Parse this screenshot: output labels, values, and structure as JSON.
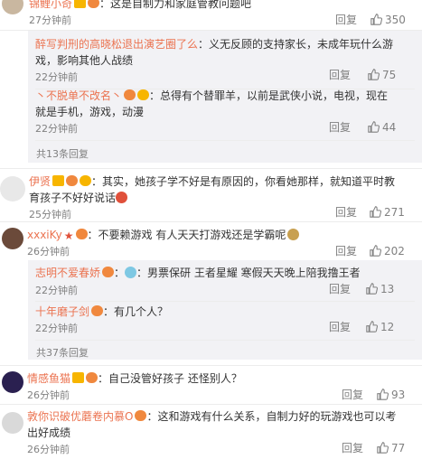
{
  "comments": [
    {
      "name": "锦鲤小奇",
      "text": "：这是自制力和家庭管教问题吧",
      "time": "27分钟前",
      "reply": "回复",
      "likes": "350"
    },
    {
      "name": "醉写判刑的高晓松退出演艺圈了么",
      "text1": "：义无反顾的支持家长，未成年玩什么游",
      "text2": "戏，影响其他人战绩",
      "time": "22分钟前",
      "reply": "回复",
      "likes": "75"
    },
    {
      "name": "丶不脱单不改名丶",
      "text1": "：总得有个替罪羊，以前是武侠小说，电视，现在",
      "text2": "就是手机，游戏，动漫",
      "time": "22分钟前",
      "reply": "回复",
      "likes": "44"
    },
    {
      "more": "共13条回复"
    },
    {
      "name": "伊贤",
      "text1": "：其实，她孩子学不好是有原因的，你看她那样，就知道平时教",
      "text2": "育孩子不好好说话",
      "time": "25分钟前",
      "reply": "回复",
      "likes": "271"
    },
    {
      "name": "xxxiKy",
      "text": "：不要赖游戏 有人天天打游戏还是学霸呢",
      "time": "26分钟前",
      "reply": "回复",
      "likes": "202"
    },
    {
      "name": "志明不爱春娇",
      "text": "：男票保研 王者星耀 寒假天天晚上陪我撸王者",
      "time": "22分钟前",
      "reply": "回复",
      "likes": "13"
    },
    {
      "name": "十年磨子剑",
      "text": "：有几个人？",
      "time": "22分钟前",
      "reply": "回复",
      "likes": "12"
    },
    {
      "more": "共37条回复"
    },
    {
      "name": "情感鱼猫",
      "text": "：自己没管好孩子 还怪别人？",
      "time": "26分钟前",
      "reply": "回复",
      "likes": "93"
    },
    {
      "name": "敦你识破优蘑卷内慕O",
      "text1": "：这和游戏有什么关系，自制力好的玩游戏也可以考",
      "text2": "出好成绩",
      "time": "26分钟前",
      "reply": "回复",
      "likes": "77"
    }
  ],
  "colors": {
    "name": "#eb7350",
    "meta": "#808080",
    "sub_bg": "#f2f2f5",
    "text": "#333333"
  }
}
